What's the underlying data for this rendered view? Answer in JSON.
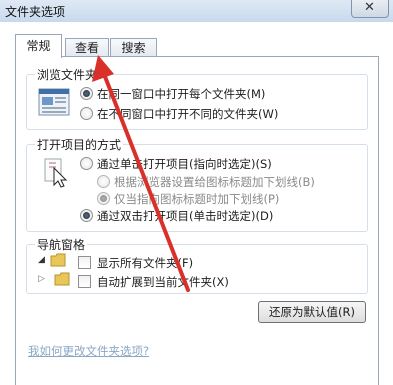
{
  "window": {
    "title": "文件夹选项",
    "close_glyph": "✕"
  },
  "tabs": [
    {
      "label": "常规",
      "active": true
    },
    {
      "label": "查看",
      "active": false
    },
    {
      "label": "搜索",
      "active": false
    }
  ],
  "browse": {
    "legend": "浏览文件夹",
    "options": [
      {
        "label": "在同一窗口中打开每个文件夹(M)",
        "selected": true
      },
      {
        "label": "在不同窗口中打开不同的文件夹(W)",
        "selected": false
      }
    ]
  },
  "open_items": {
    "legend": "打开项目的方式",
    "single_click": {
      "label": "通过单击打开项目(指向时选定)(S)",
      "selected": false
    },
    "underline_always": {
      "label": "根据浏览器设置给图标标题加下划线(B)",
      "selected": false
    },
    "underline_hover": {
      "label": "仅当指向图标标题时加下划线(P)",
      "selected": true
    },
    "double_click": {
      "label": "通过双击打开项目(单击时选定)(D)",
      "selected": true
    }
  },
  "nav_pane": {
    "legend": "导航窗格",
    "show_all": {
      "label": "显示所有文件夹(F)",
      "checked": false
    },
    "auto_expand": {
      "label": "自动扩展到当前文件夹(X)",
      "checked": false
    }
  },
  "restore_button": "还原为默认值(R)",
  "help_link": "我如何更改文件夹选项?",
  "colors": {
    "annotation_arrow": "#d9302a",
    "link": "#8ba7c6",
    "titlebar": "#c9d9ec"
  }
}
